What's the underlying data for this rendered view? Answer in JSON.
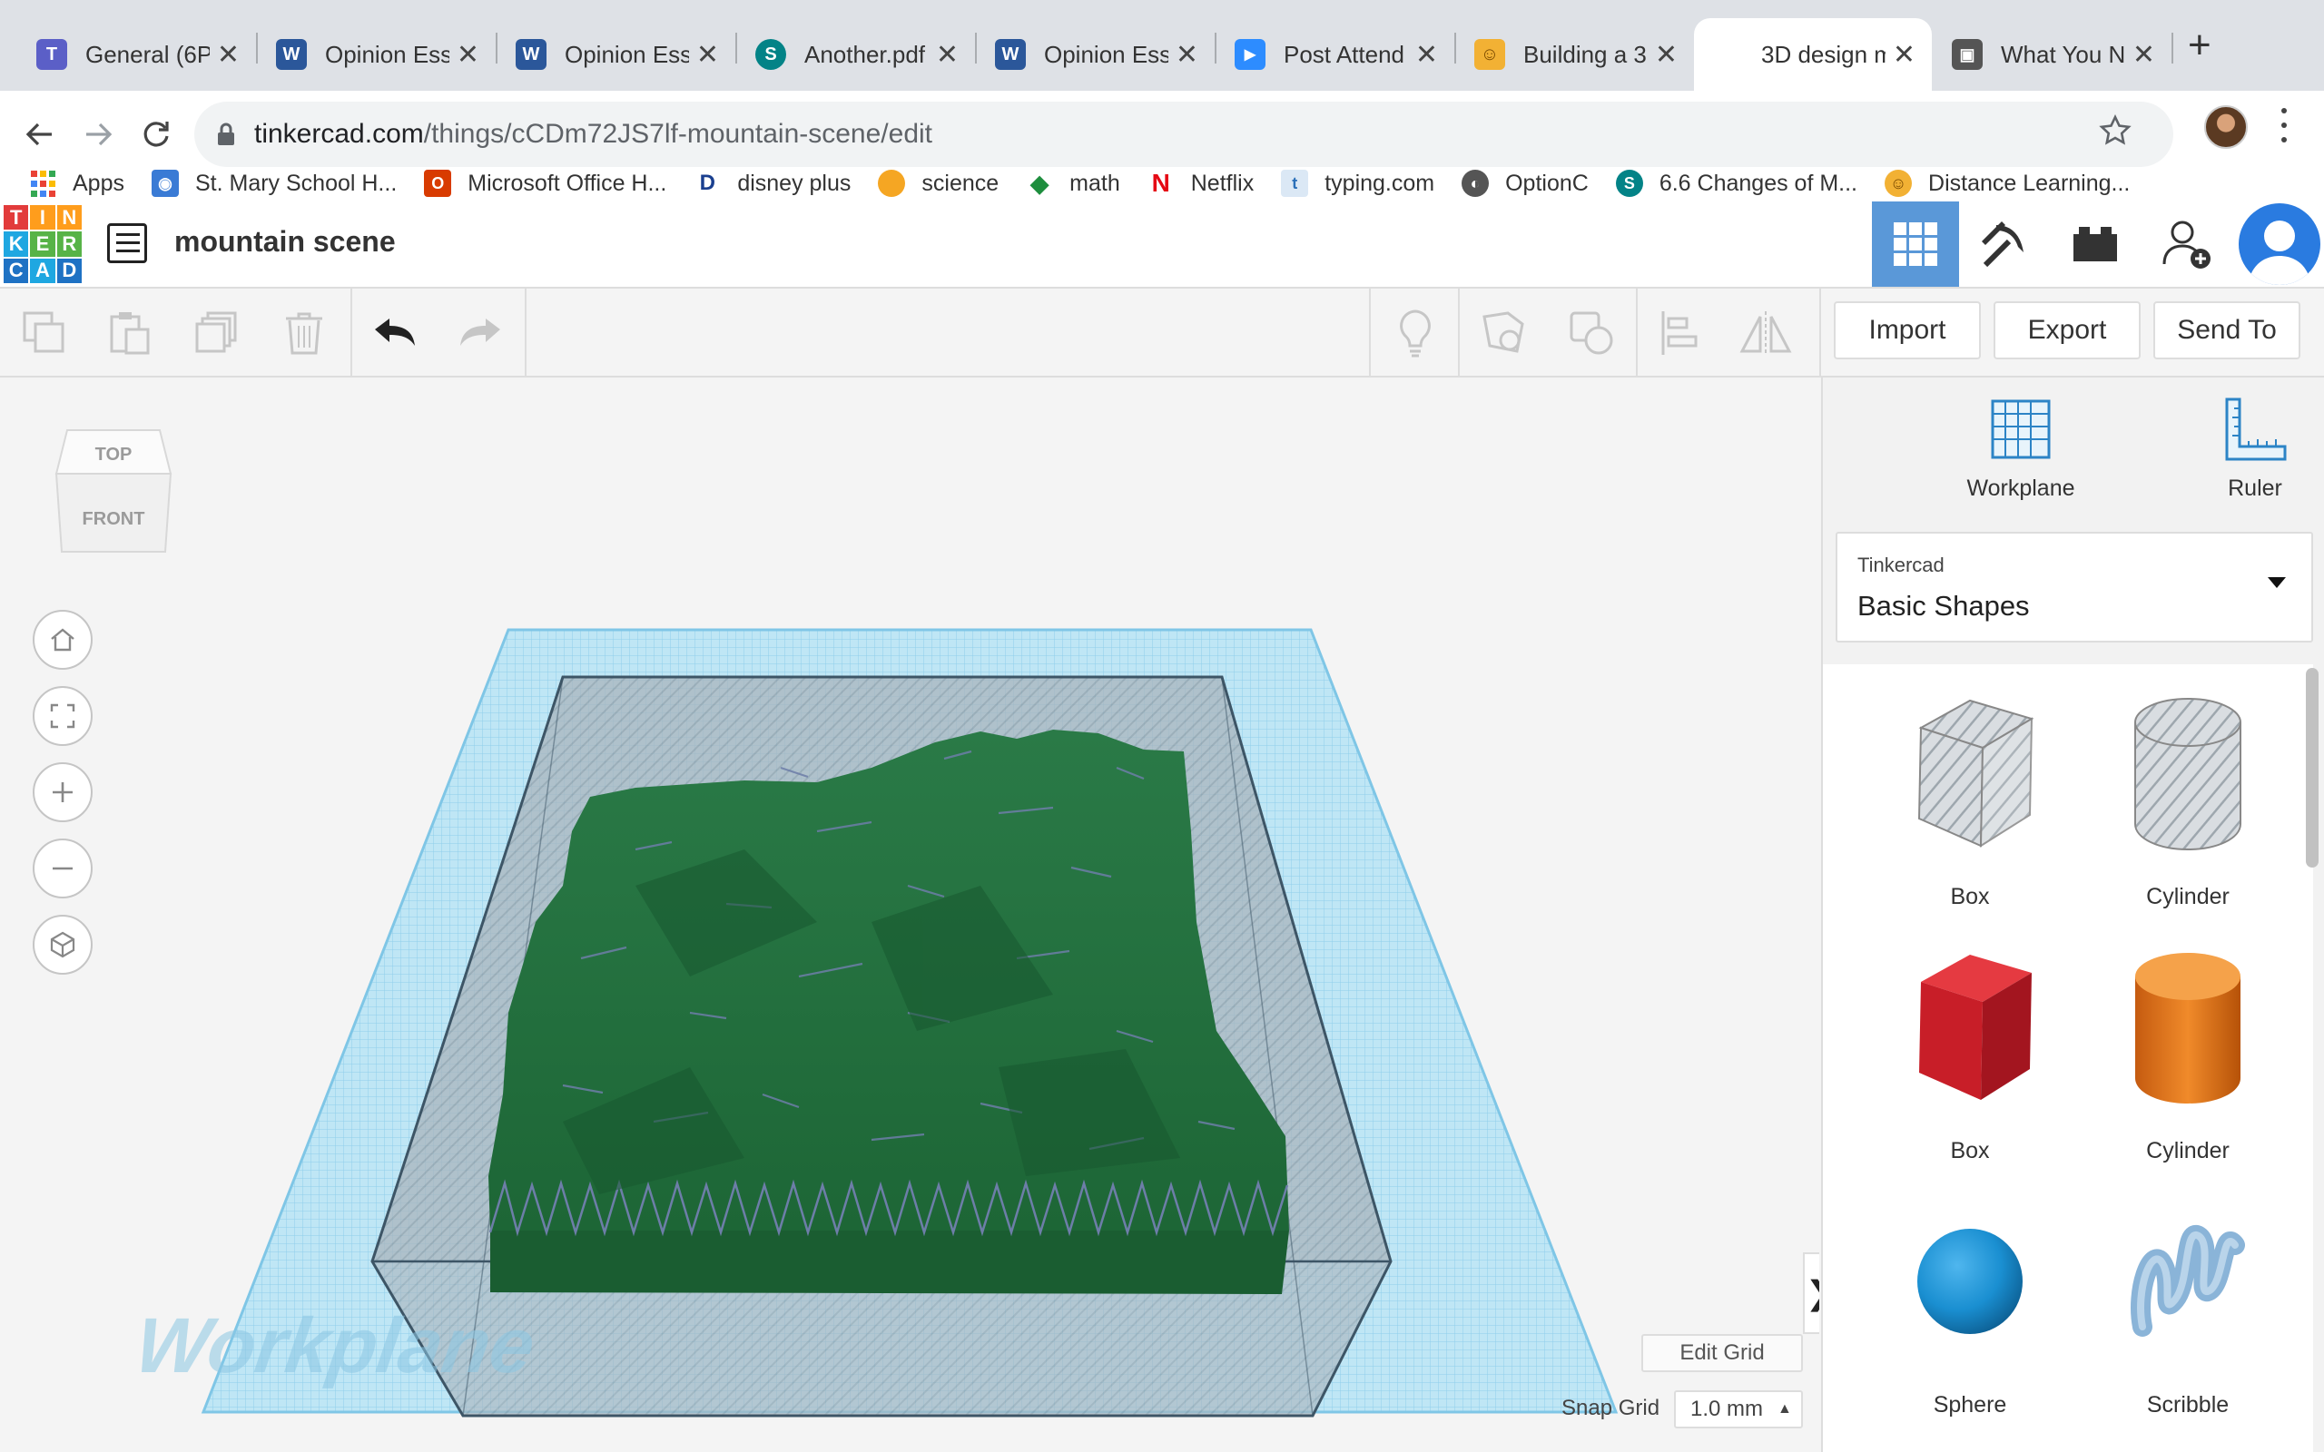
{
  "browser": {
    "tabs": [
      {
        "title": "General (6P",
        "icon": "teams-icon",
        "color": "#5b5fc7",
        "glyph": "T"
      },
      {
        "title": "Opinion Ess",
        "icon": "word-icon",
        "color": "#2b579a",
        "glyph": "W"
      },
      {
        "title": "Opinion Ess",
        "icon": "word-icon",
        "color": "#2b579a",
        "glyph": "W"
      },
      {
        "title": "Another.pdf",
        "icon": "sharepoint-icon",
        "color": "#038387",
        "glyph": "S"
      },
      {
        "title": "Opinion Ess",
        "icon": "word-icon",
        "color": "#2b579a",
        "glyph": "W"
      },
      {
        "title": "Post Attend",
        "icon": "zoom-icon",
        "color": "#2d8cff",
        "glyph": "▶"
      },
      {
        "title": "Building a 3",
        "icon": "distance-learning-icon",
        "color": "#f2b134",
        "glyph": "☺"
      },
      {
        "title": "3D design m",
        "icon": "tinkercad-icon",
        "color": "#1477d1",
        "glyph": "▦"
      },
      {
        "title": "What You N",
        "icon": "page-icon",
        "color": "#555555",
        "glyph": "▣"
      }
    ],
    "new_tab": "+",
    "url_host": "tinkercad.com",
    "url_path": "/things/cCDm72JS7lf-mountain-scene/edit",
    "bookmarks": [
      {
        "label": "Apps",
        "icon": "apps-grid-icon",
        "color": "#e94235",
        "glyph": "⁞"
      },
      {
        "label": "St. Mary School H...",
        "icon": "school-icon",
        "color": "#3a7bd5",
        "glyph": "◉"
      },
      {
        "label": "Microsoft Office H...",
        "icon": "office-icon",
        "color": "#d83b01",
        "glyph": "O"
      },
      {
        "label": "disney plus",
        "icon": "disney-icon",
        "color": "#1a3f8f",
        "glyph": "D"
      },
      {
        "label": "science",
        "icon": "science-icon",
        "color": "#f5a623",
        "glyph": ""
      },
      {
        "label": "math",
        "icon": "math-icon",
        "color": "#1e8e3e",
        "glyph": "◆"
      },
      {
        "label": "Netflix",
        "icon": "netflix-icon",
        "color": "#e50914",
        "glyph": "N"
      },
      {
        "label": "typing.com",
        "icon": "typing-icon",
        "color": "#4a90d9",
        "glyph": "t"
      },
      {
        "label": "OptionC",
        "icon": "globe-icon",
        "color": "#555555",
        "glyph": "◐"
      },
      {
        "label": "6.6 Changes of M...",
        "icon": "sharepoint-icon",
        "color": "#038387",
        "glyph": "S"
      },
      {
        "label": "Distance Learning...",
        "icon": "distance-learning-icon",
        "color": "#f2b134",
        "glyph": "☺"
      }
    ]
  },
  "app": {
    "design_title": "mountain scene",
    "logo_letters": [
      "T",
      "I",
      "N",
      "K",
      "E",
      "R",
      "C",
      "A",
      "D"
    ],
    "logo_colors": [
      "#e23b3b",
      "#ff9d1c",
      "#ff9d1c",
      "#1fa7e1",
      "#57b347",
      "#57b347",
      "#1f72c4",
      "#1fa7e1",
      "#1f72c4"
    ]
  },
  "toolbar": {
    "import_label": "Import",
    "export_label": "Export",
    "send_to_label": "Send To"
  },
  "viewport": {
    "viewcube_top": "TOP",
    "viewcube_front": "FRONT",
    "workplane_watermark": "Workplane",
    "edit_grid_label": "Edit Grid",
    "snap_grid_label": "Snap Grid",
    "snap_grid_value": "1.0 mm"
  },
  "panel": {
    "workplane_label": "Workplane",
    "ruler_label": "Ruler",
    "library_caption": "Tinkercad",
    "library_value": "Basic Shapes",
    "shapes": [
      {
        "label": "Box",
        "icon": "box-hole-icon"
      },
      {
        "label": "Cylinder",
        "icon": "cylinder-hole-icon"
      },
      {
        "label": "Box",
        "icon": "box-solid-icon",
        "color": "#c81e28"
      },
      {
        "label": "Cylinder",
        "icon": "cylinder-solid-icon",
        "color": "#e8751a"
      },
      {
        "label": "Sphere",
        "icon": "sphere-icon",
        "color": "#1a8fd1"
      },
      {
        "label": "Scribble",
        "icon": "scribble-icon",
        "color": "#8ab4d8"
      }
    ]
  },
  "colors": {
    "accent": "#5a98d8",
    "terrain": "#1f6b3a",
    "workplane": "#a9dcf0"
  }
}
